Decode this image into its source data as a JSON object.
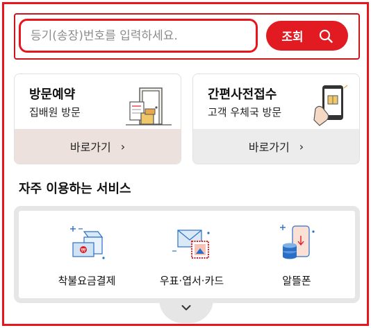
{
  "search": {
    "placeholder": "등기(송장)번호를 입력하세요.",
    "button_label": "조회"
  },
  "cards": [
    {
      "title": "방문예약",
      "subtitle": "집배원 방문",
      "action_label": "바로가기"
    },
    {
      "title": "간편사전접수",
      "subtitle": "고객 우체국 방문",
      "action_label": "바로가기"
    }
  ],
  "frequent_services": {
    "title": "자주 이용하는 서비스",
    "items": [
      {
        "label": "착불요금결제",
        "icon": "package-payment-icon"
      },
      {
        "label": "우표·엽서·카드",
        "icon": "stamp-postcard-icon"
      },
      {
        "label": "알뜰폰",
        "icon": "phone-coins-icon"
      }
    ]
  },
  "colors": {
    "accent": "#e21b22",
    "highlight_border": "#e8151b",
    "card_left_footer": "#ece1dc",
    "card_right_footer": "#ececec"
  }
}
